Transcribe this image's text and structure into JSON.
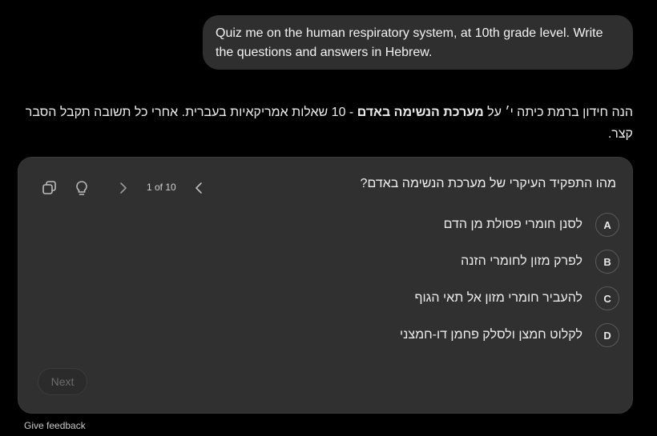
{
  "user_message": "Quiz me on the human respiratory system, at 10th grade level. Write the questions and answers in Hebrew.",
  "assistant_intro": {
    "before_bold": "הנה חידון ברמת כיתה י׳ על ",
    "bold": "מערכת הנשימה באדם",
    "after_bold": " - 10 שאלות אמריקאיות בעברית. אחרי כל תשובה תקבל הסבר קצר."
  },
  "quiz": {
    "question": "מהו התפקיד העיקרי של מערכת הנשימה באדם?",
    "counter": "1 of 10",
    "options": [
      {
        "letter": "A",
        "text": "לסנן חומרי פסולת מן הדם"
      },
      {
        "letter": "B",
        "text": "לפרק מזון לחומרי הזנה"
      },
      {
        "letter": "C",
        "text": "להעביר חומרי מזון אל תאי הגוף"
      },
      {
        "letter": "D",
        "text": "לקלוט חמצן ולסלק פחמן דו-חמצני"
      }
    ],
    "next_label": "Next",
    "icons": [
      "copy-icon",
      "lightbulb-icon",
      "chevron-right-icon",
      "chevron-left-icon"
    ]
  },
  "feedback_label": "Give feedback"
}
